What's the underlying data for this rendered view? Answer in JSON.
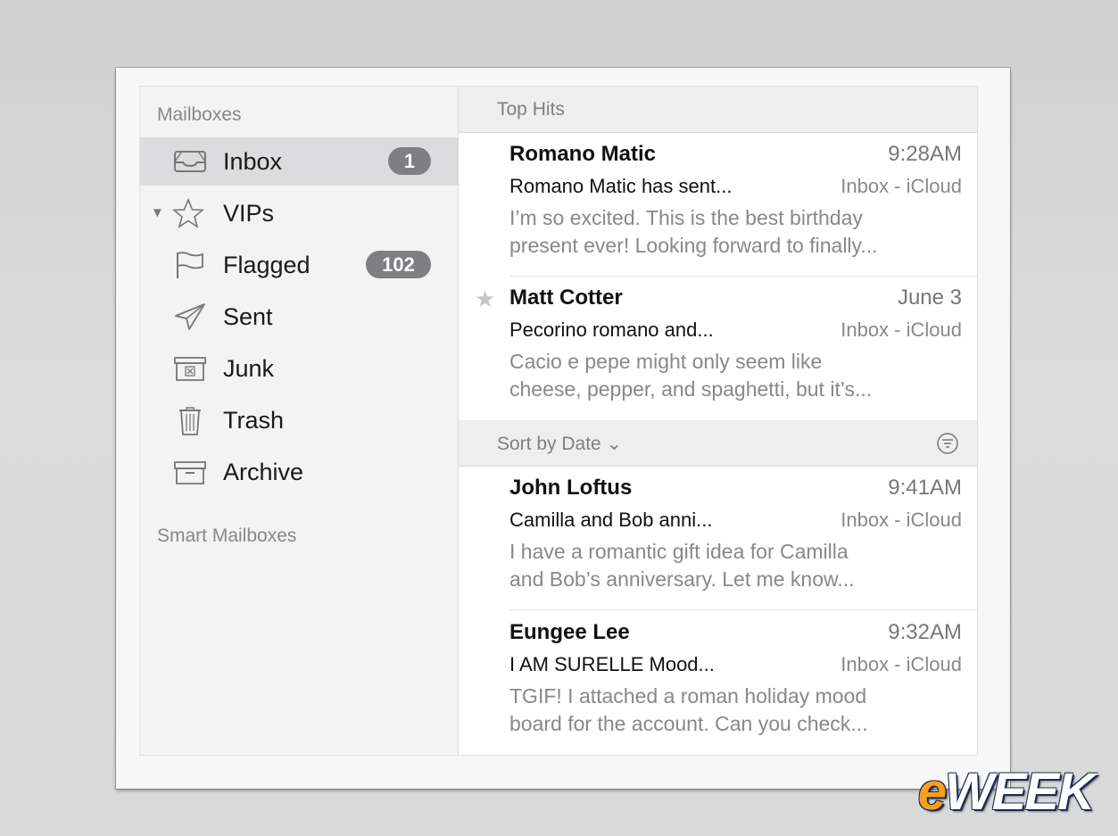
{
  "sidebar": {
    "mailboxes_header": "Mailboxes",
    "smart_mailboxes_header": "Smart Mailboxes",
    "items": [
      {
        "label": "Inbox",
        "icon": "inbox-tray-icon",
        "badge": "1",
        "selected": true
      },
      {
        "label": "VIPs",
        "icon": "star-outline-icon",
        "disclosure": "▼"
      },
      {
        "label": "Flagged",
        "icon": "flag-icon",
        "badge": "102"
      },
      {
        "label": "Sent",
        "icon": "paper-plane-icon"
      },
      {
        "label": "Junk",
        "icon": "junk-box-icon"
      },
      {
        "label": "Trash",
        "icon": "trash-can-icon"
      },
      {
        "label": "Archive",
        "icon": "archive-box-icon"
      }
    ]
  },
  "list": {
    "top_hits_label": "Top Hits",
    "sort_label": "Sort by Date ⌄",
    "top_hits": [
      {
        "sender": "Romano Matic",
        "time": "9:28AM",
        "subject": "Romano Matic has sent...",
        "mailbox": "Inbox - iCloud",
        "preview_line1": "I’m so excited. This is the best birthday",
        "preview_line2": "present ever! Looking forward to finally..."
      },
      {
        "sender": "Matt Cotter",
        "time": "June 3",
        "subject": "Pecorino romano and...",
        "mailbox": "Inbox - iCloud",
        "preview_line1": "Cacio e pepe might only seem like",
        "preview_line2": "cheese, pepper, and spaghetti, but it’s...",
        "vip_star": "★"
      }
    ],
    "messages": [
      {
        "sender": "John Loftus",
        "time": "9:41AM",
        "subject": "Camilla and Bob anni...",
        "mailbox": "Inbox - iCloud",
        "preview_line1": "I have a romantic gift idea for Camilla",
        "preview_line2": "and Bob’s anniversary. Let me know..."
      },
      {
        "sender": "Eungee Lee",
        "time": "9:32AM",
        "subject": "I AM SURELLE Mood...",
        "mailbox": "Inbox - iCloud",
        "preview_line1": "TGIF! I attached a roman holiday mood",
        "preview_line2": "board for the account. Can you check..."
      }
    ]
  },
  "watermark": {
    "prefix": "e",
    "rest": "WEEK"
  },
  "colors": {
    "badge": "#7f7f83",
    "selected_row": "#dcdcde",
    "logo_accent": "#f4a21c"
  }
}
